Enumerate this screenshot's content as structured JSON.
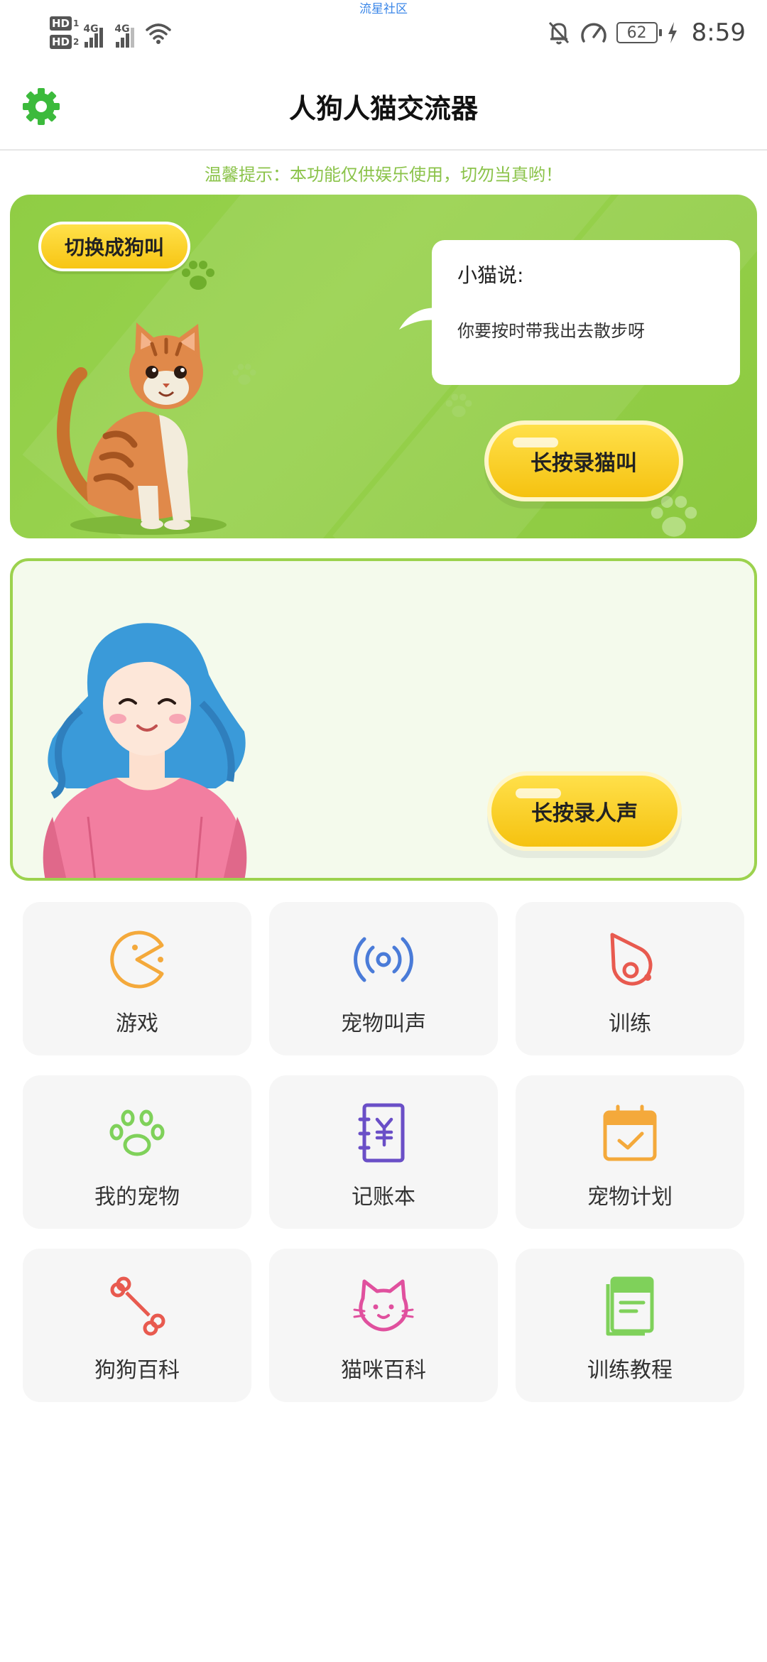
{
  "status_bar": {
    "watermark": "流星社区",
    "sim1": "HD",
    "sim1_num": "1",
    "sim2": "HD",
    "sim2_num": "2",
    "net1": "4G",
    "net2": "4G",
    "battery": "62",
    "time": "8:59"
  },
  "header": {
    "title": "人狗人猫交流器",
    "settings_icon": "gear-icon"
  },
  "tip": "温馨提示：本功能仅供娱乐使用，切勿当真哟！",
  "cat_card": {
    "switch_label": "切换成狗叫",
    "speaker": "小猫说:",
    "message": "你要按时带我出去散步呀",
    "record_label": "长按录猫叫"
  },
  "human_card": {
    "record_label": "长按录人声"
  },
  "features": [
    {
      "label": "游戏",
      "icon": "pacman-icon"
    },
    {
      "label": "宠物叫声",
      "icon": "sound-wave-icon"
    },
    {
      "label": "训练",
      "icon": "whistle-icon"
    },
    {
      "label": "我的宠物",
      "icon": "paw-icon"
    },
    {
      "label": "记账本",
      "icon": "ledger-icon"
    },
    {
      "label": "宠物计划",
      "icon": "calendar-check-icon"
    },
    {
      "label": "狗狗百科",
      "icon": "bone-icon"
    },
    {
      "label": "猫咪百科",
      "icon": "cat-face-icon"
    },
    {
      "label": "训练教程",
      "icon": "book-icon"
    }
  ],
  "colors": {
    "accent_green": "#8fcd44",
    "tip_green": "#8bc34a",
    "button_yellow": "#f7c514",
    "gear_green": "#3cba3c"
  }
}
